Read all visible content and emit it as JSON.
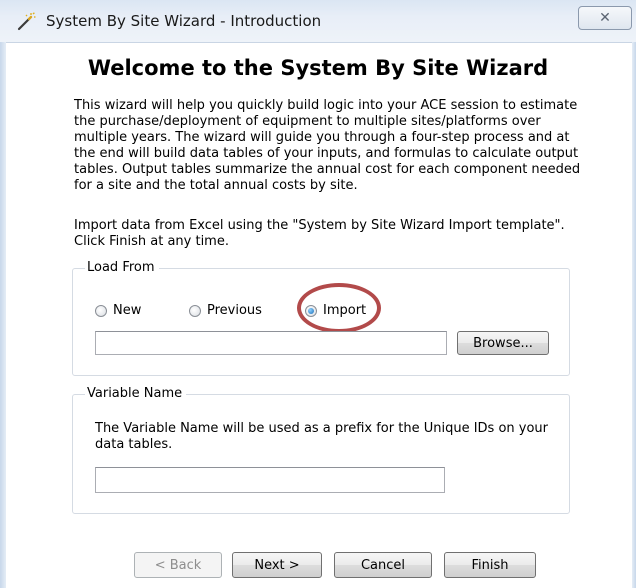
{
  "window": {
    "title": "System By Site Wizard - Introduction",
    "close_glyph": "✕"
  },
  "main": {
    "heading": "Welcome to the System By Site Wizard",
    "intro_paragraph": "This wizard will help you quickly build logic into your ACE session to estimate the purchase/deployment of equipment to multiple sites/platforms over multiple years. The wizard will guide you through a four-step process and at the end will build data tables of your inputs, and formulas to calculate output tables. Output tables summarize the annual cost for each component needed for a site and the total annual costs by site.",
    "import_paragraph": "Import data from Excel using the \"System by Site Wizard Import template\". Click Finish at any time."
  },
  "load_from": {
    "legend": "Load From",
    "options": [
      {
        "label": "New",
        "checked": false
      },
      {
        "label": "Previous",
        "checked": false
      },
      {
        "label": "Import",
        "checked": true
      }
    ],
    "path_value": "",
    "browse_label": "Browse..."
  },
  "variable_name": {
    "legend": "Variable Name",
    "description": "The Variable Name will be used as a prefix for the Unique IDs on your data tables.",
    "value": ""
  },
  "footer": {
    "back_label": "< Back",
    "next_label": "Next >",
    "cancel_label": "Cancel",
    "finish_label": "Finish"
  },
  "colors": {
    "highlight_ring": "#b24a4a"
  }
}
